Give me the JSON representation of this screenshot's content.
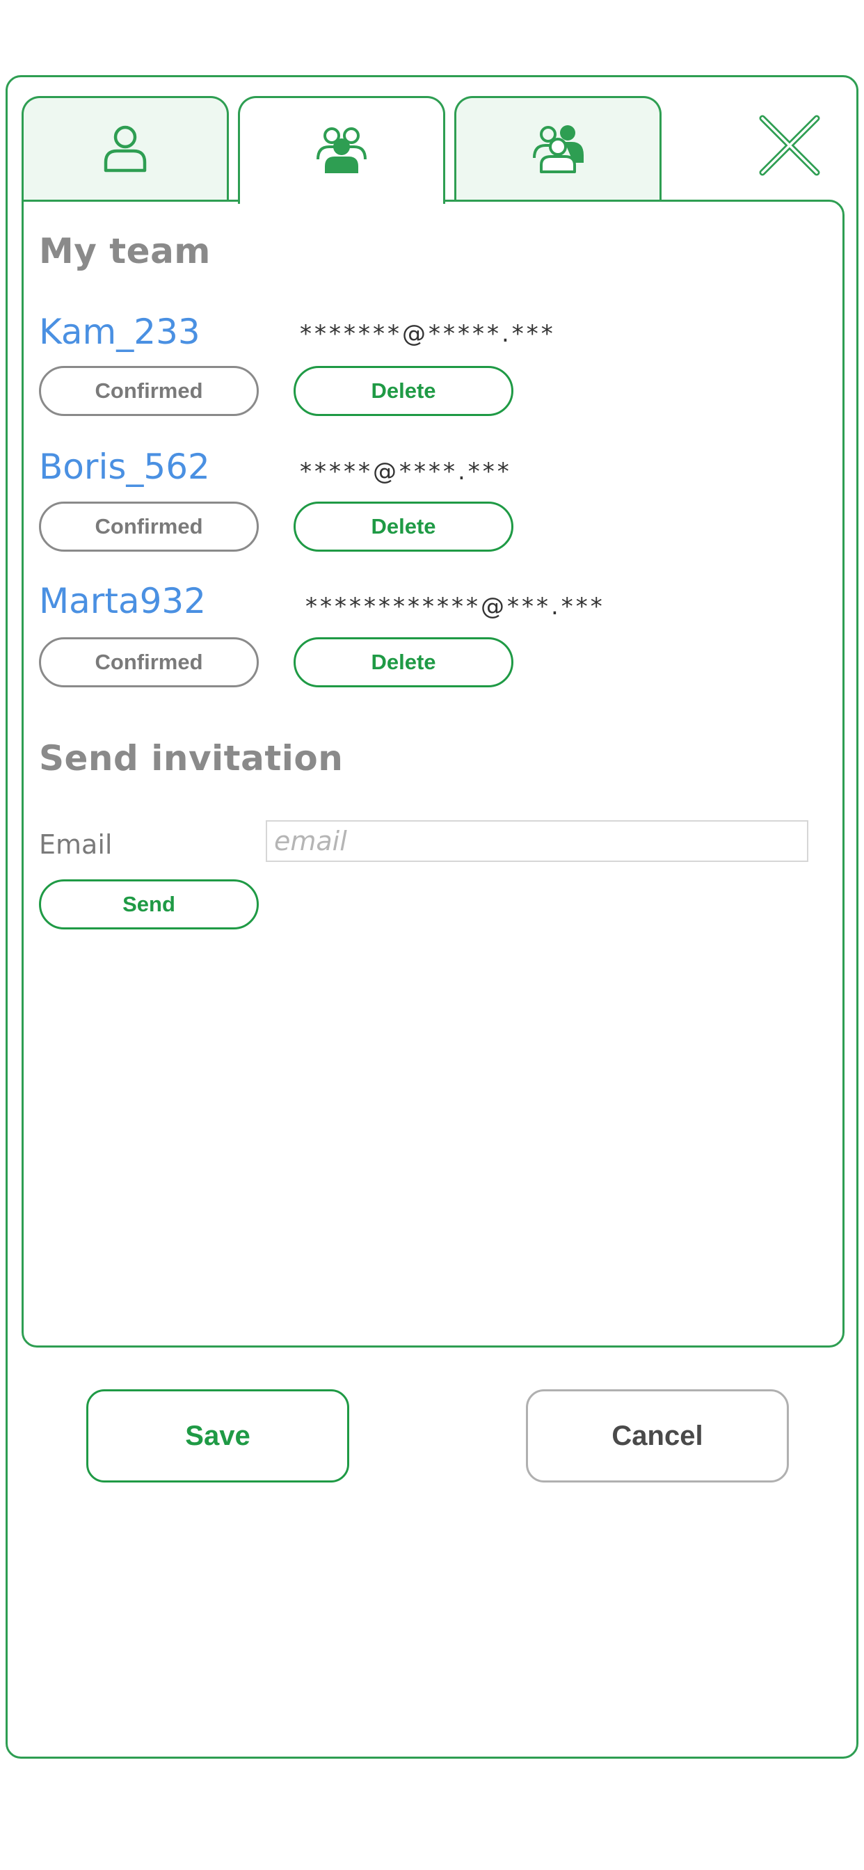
{
  "tabs": [
    {
      "icon": "user-icon",
      "active": false
    },
    {
      "icon": "team-icon",
      "active": true
    },
    {
      "icon": "team-invite-icon",
      "active": false
    }
  ],
  "close_icon": "close-icon",
  "team": {
    "title": "My team",
    "members": [
      {
        "name": "Kam_233",
        "email": "*******@*****.***",
        "status": "Confirmed",
        "delete_label": "Delete"
      },
      {
        "name": "Boris_562",
        "email": "*****@****.***",
        "status": "Confirmed",
        "delete_label": "Delete"
      },
      {
        "name": "Marta932",
        "email": "************@***.***",
        "status": "Confirmed",
        "delete_label": "Delete"
      }
    ]
  },
  "invitation": {
    "title": "Send invitation",
    "email_label": "Email",
    "email_placeholder": "email",
    "email_value": "",
    "send_label": "Send"
  },
  "footer": {
    "save_label": "Save",
    "cancel_label": "Cancel"
  },
  "colors": {
    "accent_green": "#1f9a45",
    "frame_green": "#2e9e52",
    "name_blue": "#4a90e2",
    "muted_gray": "#8a8a8a"
  }
}
